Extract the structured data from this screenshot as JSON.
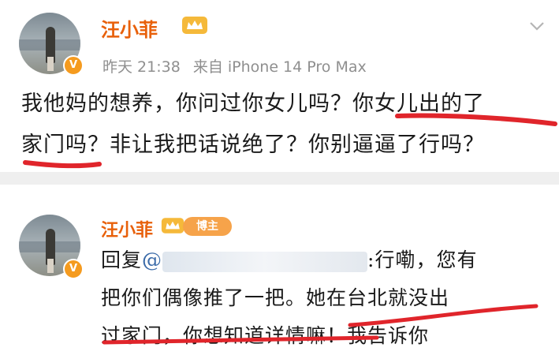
{
  "post1": {
    "author": "汪小菲",
    "time": "昨天 21:38",
    "source": "来自 iPhone 14 Pro Max",
    "lines": [
      "我他妈的想养，你问过你女儿吗？你女儿出的了",
      "家门吗？非让我把话说绝了？你别逼逼了行吗？"
    ]
  },
  "post2": {
    "author": "汪小菲",
    "tag": "博主",
    "reply_prefix": "回复",
    "mention": "@",
    "lines": [
      ":行嘞，您有",
      "把你们偶像推了一把。她在台北就没出",
      "过家门，你想知道详情嘛！我告诉你"
    ]
  },
  "icons": {
    "crown": "crown-icon",
    "verified": "verified-v-icon",
    "more": "chevron-down-icon"
  },
  "colors": {
    "name": "#e8600a",
    "verified": "#f59b1f",
    "annotation": "#e0252b"
  }
}
